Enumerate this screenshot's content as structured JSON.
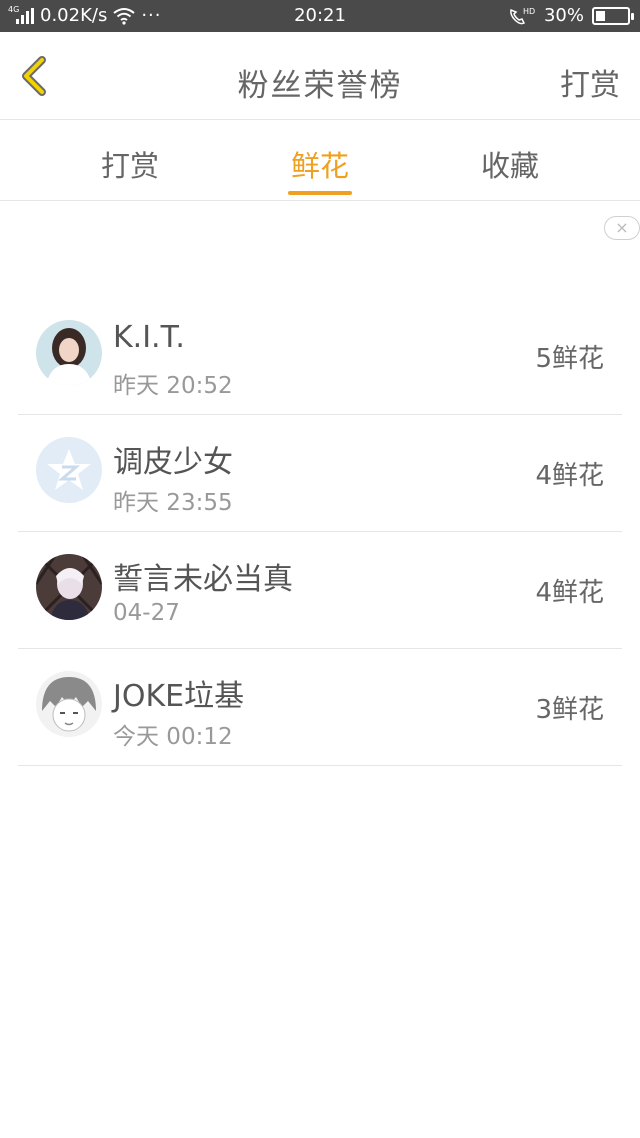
{
  "status_bar": {
    "network_type": "4G",
    "speed": "0.02K/s",
    "more": "···",
    "time": "20:21",
    "call_badge": "HD",
    "battery": "30%",
    "battery_level": 0.3
  },
  "nav": {
    "title": "粉丝荣誉榜",
    "action_label": "打赏",
    "back_icon": "chevron-left-icon",
    "accent_color": "#f0a020"
  },
  "tabs": [
    {
      "label": "打赏",
      "active": false
    },
    {
      "label": "鲜花",
      "active": true
    },
    {
      "label": "收藏",
      "active": false
    }
  ],
  "ad_close": "×",
  "fans": [
    {
      "name": "K.I.T.",
      "time": "昨天 20:52",
      "flowers": "5鲜花"
    },
    {
      "name": "调皮少女",
      "time": "昨天 23:55",
      "flowers": "4鲜花"
    },
    {
      "name": "誓言未必当真",
      "time": "04-27",
      "flowers": "4鲜花"
    },
    {
      "name": "JOKE垃基",
      "time": "今天 00:12",
      "flowers": "3鲜花"
    }
  ]
}
